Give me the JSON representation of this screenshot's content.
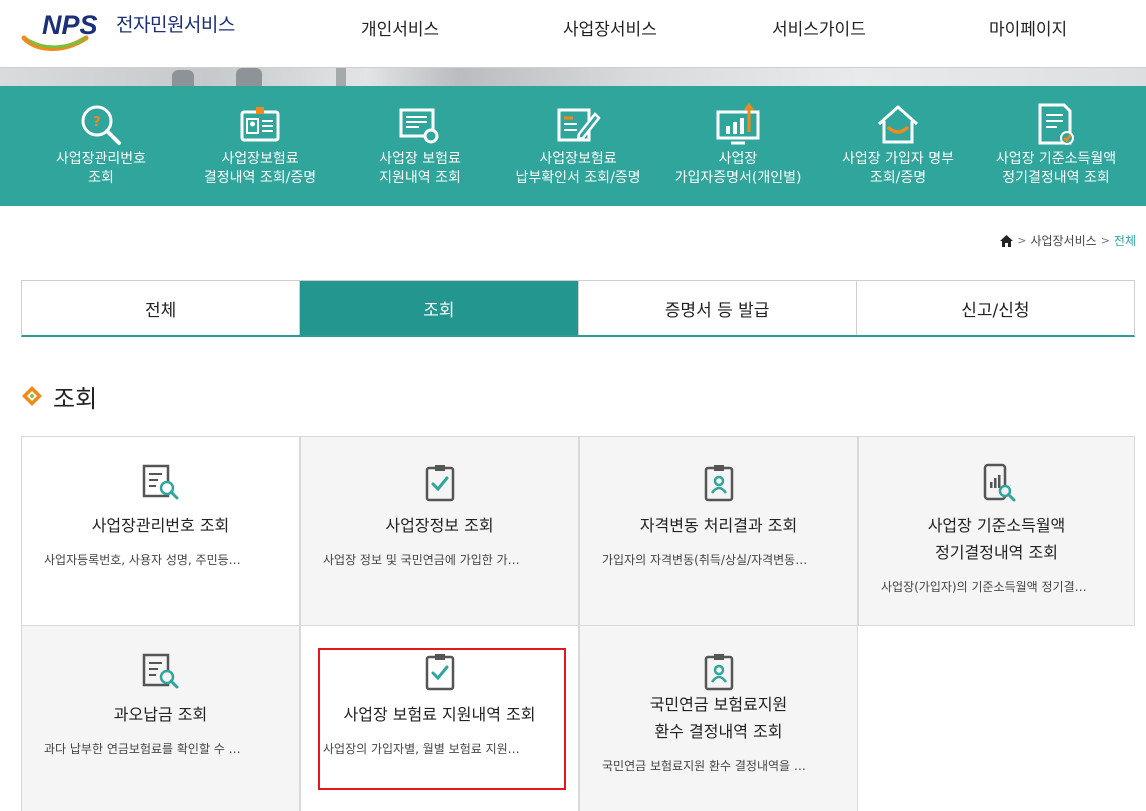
{
  "header": {
    "logo_text": "전자민원서비스",
    "nav": [
      "개인서비스",
      "사업장서비스",
      "서비스가이드",
      "마이페이지"
    ]
  },
  "quick_menu": [
    {
      "label": "사업장관리번호\n조회",
      "icon": "search-icon"
    },
    {
      "label": "사업장보험료\n결정내역 조회/증명",
      "icon": "id-card-icon"
    },
    {
      "label": "사업장 보험료\n지원내역 조회",
      "icon": "document-search-icon"
    },
    {
      "label": "사업장보험료\n납부확인서 조회/증명",
      "icon": "document-edit-icon"
    },
    {
      "label": "사업장\n가입자증명서(개인별)",
      "icon": "monitor-chart-icon"
    },
    {
      "label": "사업장 가입자 명부\n조회/증명",
      "icon": "house-icon"
    },
    {
      "label": "사업장 기준소득월액\n정기결정내역 조회",
      "icon": "document-check-icon"
    }
  ],
  "breadcrumb": {
    "items": [
      "사업장서비스",
      "전체"
    ]
  },
  "tabs": [
    {
      "label": "전체",
      "active": false
    },
    {
      "label": "조회",
      "active": true
    },
    {
      "label": "증명서 등 발급",
      "active": false
    },
    {
      "label": "신고/신청",
      "active": false
    }
  ],
  "section_title": "조회",
  "cards": [
    {
      "title": "사업장관리번호 조회",
      "desc": "사업자등록번호, 사용자 성명, 주민등…",
      "icon": "document-search-icon"
    },
    {
      "title": "사업장정보 조회",
      "desc": "사업장 정보 및 국민연금에 가입한 가…",
      "icon": "clipboard-check-icon"
    },
    {
      "title": "자격변동 처리결과 조회",
      "desc": "가입자의 자격변동(취득/상실/자격변동…",
      "icon": "clipboard-person-icon"
    },
    {
      "title": "사업장 기준소득월액\n정기결정내역 조회",
      "desc": "사업장(가입자)의 기준소득월액 정기결…",
      "icon": "phone-chart-icon"
    },
    {
      "title": "과오납금 조회",
      "desc": "과다 납부한 연금보험료를 확인할 수 …",
      "icon": "document-search-icon"
    },
    {
      "title": "사업장 보험료 지원내역 조회",
      "desc": "사업장의 가입자별, 월별 보험료 지원…",
      "icon": "clipboard-check-icon"
    },
    {
      "title": "국민연금 보험료지원\n환수 결정내역 조회",
      "desc": "국민연금 보험료지원 환수 결정내역을 …",
      "icon": "clipboard-person-icon"
    }
  ],
  "colors": {
    "teal": "#2fa59c",
    "tab_active": "#23968f",
    "highlight": "#e5161e",
    "accent_orange": "#f08a1c",
    "accent_green": "#7bbf3a"
  }
}
